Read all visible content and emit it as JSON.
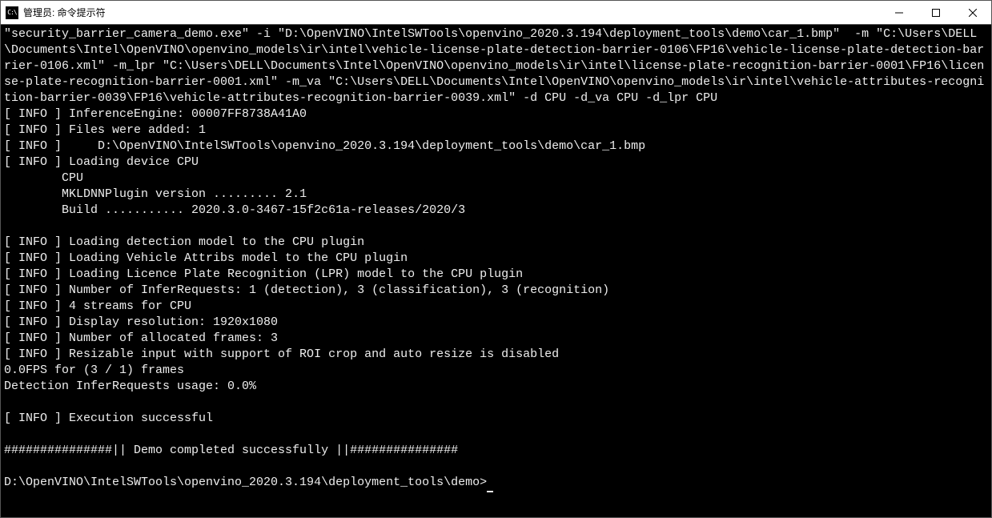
{
  "window": {
    "icon_text": "C:\\",
    "title": "管理员: 命令提示符"
  },
  "terminal": {
    "lines": [
      "\"security_barrier_camera_demo.exe\" -i \"D:\\OpenVINO\\IntelSWTools\\openvino_2020.3.194\\deployment_tools\\demo\\car_1.bmp\"  -m \"C:\\Users\\DELL\\Documents\\Intel\\OpenVINO\\openvino_models\\ir\\intel\\vehicle-license-plate-detection-barrier-0106\\FP16\\vehicle-license-plate-detection-barrier-0106.xml\" -m_lpr \"C:\\Users\\DELL\\Documents\\Intel\\OpenVINO\\openvino_models\\ir\\intel\\license-plate-recognition-barrier-0001\\FP16\\license-plate-recognition-barrier-0001.xml\" -m_va \"C:\\Users\\DELL\\Documents\\Intel\\OpenVINO\\openvino_models\\ir\\intel\\vehicle-attributes-recognition-barrier-0039\\FP16\\vehicle-attributes-recognition-barrier-0039.xml\" -d CPU -d_va CPU -d_lpr CPU",
      "[ INFO ] InferenceEngine: 00007FF8738A41A0",
      "[ INFO ] Files were added: 1",
      "[ INFO ]     D:\\OpenVINO\\IntelSWTools\\openvino_2020.3.194\\deployment_tools\\demo\\car_1.bmp",
      "[ INFO ] Loading device CPU",
      "        CPU",
      "        MKLDNNPlugin version ......... 2.1",
      "        Build ........... 2020.3.0-3467-15f2c61a-releases/2020/3",
      "",
      "[ INFO ] Loading detection model to the CPU plugin",
      "[ INFO ] Loading Vehicle Attribs model to the CPU plugin",
      "[ INFO ] Loading Licence Plate Recognition (LPR) model to the CPU plugin",
      "[ INFO ] Number of InferRequests: 1 (detection), 3 (classification), 3 (recognition)",
      "[ INFO ] 4 streams for CPU",
      "[ INFO ] Display resolution: 1920x1080",
      "[ INFO ] Number of allocated frames: 3",
      "[ INFO ] Resizable input with support of ROI crop and auto resize is disabled",
      "0.0FPS for (3 / 1) frames",
      "Detection InferRequests usage: 0.0%",
      "",
      "[ INFO ] Execution successful",
      "",
      "###############|| Demo completed successfully ||###############",
      ""
    ],
    "prompt": "D:\\OpenVINO\\IntelSWTools\\openvino_2020.3.194\\deployment_tools\\demo>"
  }
}
